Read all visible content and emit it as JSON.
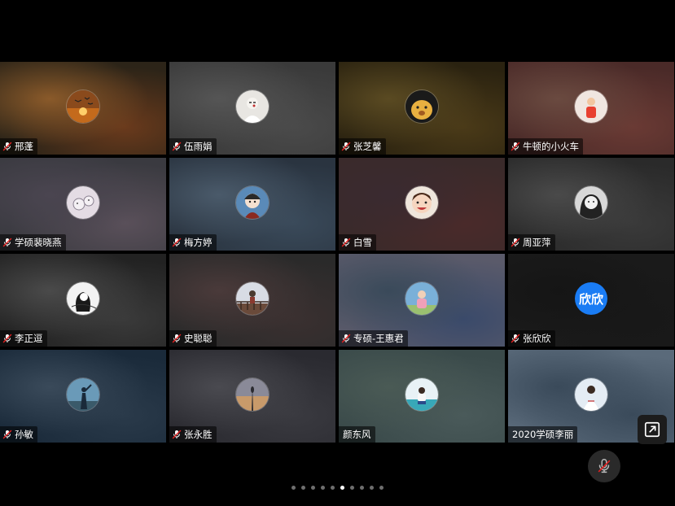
{
  "participants": [
    {
      "name": "邢蓬",
      "muted": true,
      "avatar": "sunset-birds",
      "bg": [
        "#6a3a1c",
        "#2c2418",
        "#8a5a2a"
      ]
    },
    {
      "name": "伍雨娟",
      "muted": true,
      "avatar": "white-figure",
      "bg": [
        "#4a4a4a",
        "#3a3a3a",
        "#555555"
      ]
    },
    {
      "name": "张芝馨",
      "muted": true,
      "avatar": "golden-dog",
      "bg": [
        "#4a3a18",
        "#2a2210",
        "#5a4a22"
      ]
    },
    {
      "name": "牛顿的小火车",
      "muted": true,
      "avatar": "red-figure",
      "bg": [
        "#6a3a34",
        "#4a2a28",
        "#6a4a40"
      ]
    },
    {
      "name": "学硕裴晓燕",
      "muted": true,
      "avatar": "sketch-animal",
      "bg": [
        "#5a505a",
        "#3a3a40",
        "#4a4550"
      ]
    },
    {
      "name": "梅方婷",
      "muted": true,
      "avatar": "cartoon-girl",
      "bg": [
        "#3a4a5a",
        "#2a3440",
        "#4a5a6a"
      ]
    },
    {
      "name": "白雪",
      "muted": true,
      "avatar": "smiling-girl",
      "bg": [
        "#4a2a2a",
        "#3a2a2a",
        "#3a2a30"
      ]
    },
    {
      "name": "周亚萍",
      "muted": true,
      "avatar": "bw-girl",
      "bg": [
        "#3a3a3a",
        "#2a2a2a",
        "#4a4a4a"
      ]
    },
    {
      "name": "李正逗",
      "muted": true,
      "avatar": "sketch-girl",
      "bg": [
        "#3a3a3a",
        "#222222",
        "#4a4a4a"
      ]
    },
    {
      "name": "史聪聪",
      "muted": true,
      "avatar": "railing-scene",
      "bg": [
        "#3a3030",
        "#2a2a2a",
        "#4a3a3a"
      ]
    },
    {
      "name": "专硕-王惠君",
      "muted": true,
      "avatar": "pink-girl",
      "bg": [
        "#3a4a6a",
        "#5a5a6a",
        "#3a4a5a"
      ]
    },
    {
      "name": "张欣欣",
      "muted": true,
      "avatar": "initials",
      "initials": "欣欣",
      "bg": [
        "#181818",
        "#1a1a1a",
        "#151515"
      ]
    },
    {
      "name": "孙敏",
      "muted": true,
      "avatar": "blue-figure",
      "bg": [
        "#2a3a4a",
        "#1a2a3a",
        "#3a4a5a"
      ]
    },
    {
      "name": "张永胜",
      "muted": true,
      "avatar": "tower-sunset",
      "bg": [
        "#3a3a40",
        "#2a2a30",
        "#4a4a50"
      ]
    },
    {
      "name": "颜东风",
      "muted": false,
      "avatar": "beach-person",
      "bg": [
        "#4a5a5a",
        "#3a4a4a",
        "#4a5a55"
      ]
    },
    {
      "name": "2020学硕李丽",
      "muted": false,
      "avatar": "white-shirt",
      "bg": [
        "#3a4a5a",
        "#5a6a7a",
        "#3a4a5a"
      ]
    }
  ],
  "pager": {
    "count": 10,
    "active": 5
  },
  "icons": {
    "mic_muted": "mic-muted-icon",
    "share": "share-screen-icon",
    "self_mic": "mic-off-icon"
  },
  "colors": {
    "background": "#000000",
    "mute_red": "#e02020",
    "initials_avatar": "#1a7cf4",
    "dot_active": "#ffffff",
    "dot_inactive": "#6e6e6e"
  }
}
